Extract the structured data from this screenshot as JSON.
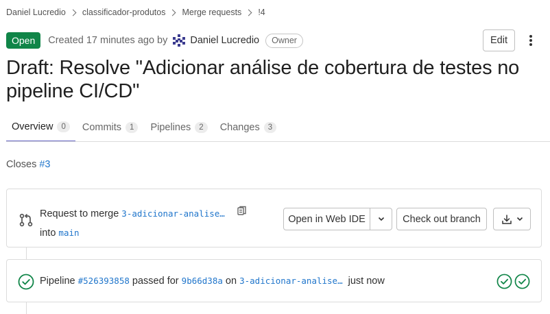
{
  "breadcrumb": {
    "items": [
      "Daniel Lucredio",
      "classificador-produtos",
      "Merge requests",
      "!4"
    ]
  },
  "header": {
    "status": "Open",
    "created_text": "Created 17 minutes ago by",
    "author": "Daniel Lucredio",
    "role_badge": "Owner",
    "edit_label": "Edit"
  },
  "title": "Draft: Resolve \"Adicionar análise de cobertura de testes no pipeline CI/CD\"",
  "tabs": [
    {
      "label": "Overview",
      "count": "0",
      "active": true
    },
    {
      "label": "Commits",
      "count": "1",
      "active": false
    },
    {
      "label": "Pipelines",
      "count": "2",
      "active": false
    },
    {
      "label": "Changes",
      "count": "3",
      "active": false
    }
  ],
  "closes": {
    "prefix": "Closes",
    "issue": "#3"
  },
  "merge_widget": {
    "request_prefix": "Request to merge",
    "source_branch": "3-adicionar-analise…",
    "into_prefix": "into",
    "target_branch": "main",
    "web_ide_label": "Open in Web IDE",
    "checkout_label": "Check out branch"
  },
  "pipeline": {
    "prefix": "Pipeline",
    "id": "#526393858",
    "passed_for": "passed for",
    "commit": "9b66d38a",
    "on": "on",
    "branch": "3-adicionar-analise…",
    "time": "just now"
  },
  "colors": {
    "open_badge": "#108548",
    "link": "#1f75cb",
    "success": "#108548",
    "active_tab_underline": "#6666c4"
  }
}
